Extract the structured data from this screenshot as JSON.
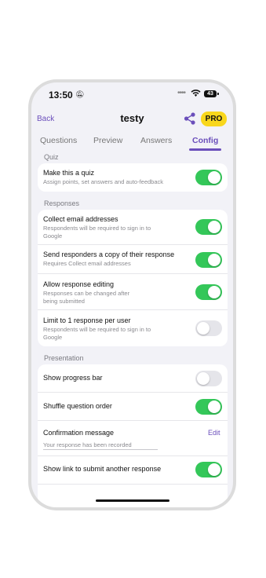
{
  "status": {
    "time": "13:50",
    "battery": "43"
  },
  "nav": {
    "back": "Back",
    "title": "testy",
    "pro": "PRO"
  },
  "tabs": [
    {
      "label": "Questions"
    },
    {
      "label": "Preview"
    },
    {
      "label": "Answers"
    },
    {
      "label": "Config",
      "active": true
    }
  ],
  "sections": {
    "quiz": {
      "header": "Quiz",
      "rows": [
        {
          "title": "Make this a quiz",
          "subtitle": "Assign points, set answers and auto-feedback",
          "on": true
        }
      ]
    },
    "responses": {
      "header": "Responses",
      "rows": [
        {
          "title": "Collect email addresses",
          "subtitle": "Respondents will be required to sign in to Google",
          "on": true
        },
        {
          "title": "Send responders a copy of their response",
          "subtitle": "Requires Collect email addresses",
          "on": true
        },
        {
          "title": "Allow response editing",
          "subtitle": "Responses can be changed after being submitted",
          "on": true
        },
        {
          "title": "Limit to 1 response per user",
          "subtitle": "Respondents will be required to sign in to Google",
          "on": false
        }
      ]
    },
    "presentation": {
      "header": "Presentation",
      "rows": [
        {
          "title": "Show progress bar",
          "on": false
        },
        {
          "title": "Shuffle question order",
          "on": true
        }
      ],
      "confirmation": {
        "title": "Confirmation message",
        "edit": "Edit",
        "placeholder": "Your response has been recorded"
      },
      "rows_after": [
        {
          "title": "Show link to submit another response",
          "on": true
        }
      ]
    }
  },
  "colors": {
    "accent": "#6b4fbb",
    "toggle_on": "#34c759",
    "toggle_off": "#e5e5ea",
    "pro": "#f9d71c"
  }
}
